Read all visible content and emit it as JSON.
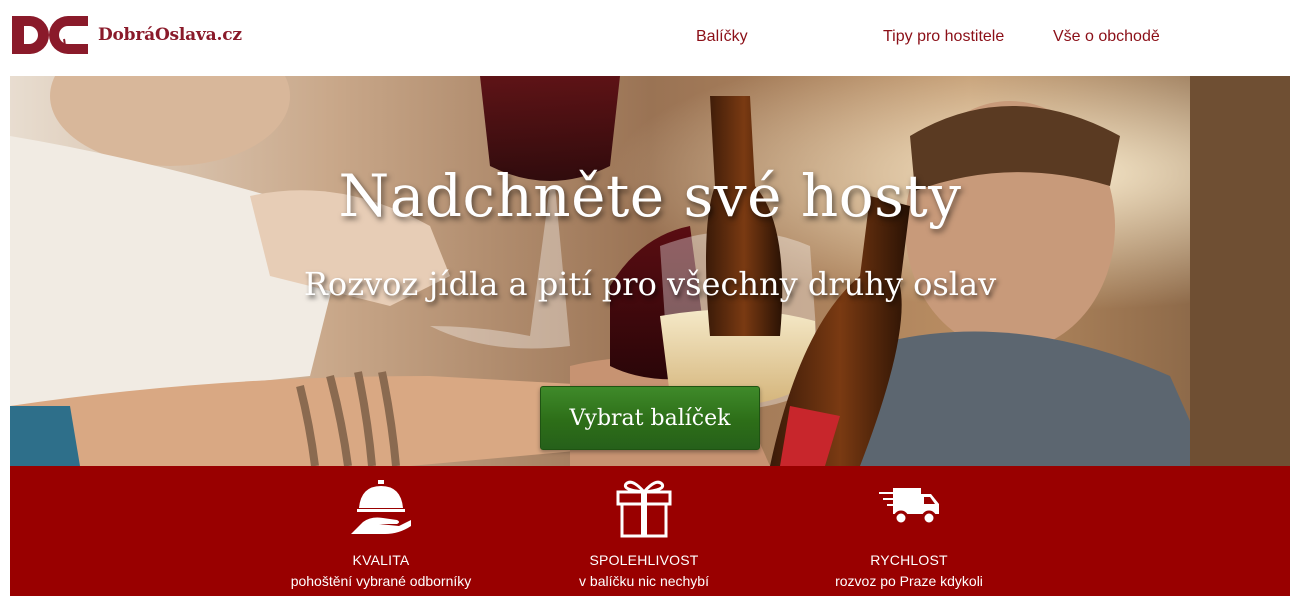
{
  "header": {
    "logo_text": "DobráOslava.cz",
    "nav": [
      "Balíčky",
      "Tipy pro hostitele",
      "Vše o obchodě"
    ]
  },
  "hero": {
    "title": "Nadchněte své hosty",
    "subtitle": "Rozvoz jídla a pití pro všechny druhy oslav",
    "cta": "Vybrat balíček"
  },
  "features": [
    {
      "icon": "cloche-icon",
      "title": "KVALITA",
      "desc": "pohoštění vybrané odborníky"
    },
    {
      "icon": "gift-icon",
      "title": "SPOLEHLIVOST",
      "desc": "v balíčku nic nechybí"
    },
    {
      "icon": "truck-icon",
      "title": "RYCHLOST",
      "desc": "rozvoz po Praze kdykoli"
    }
  ],
  "colors": {
    "brand": "#8b0f17",
    "band": "#990000",
    "cta": "#2d6e18"
  }
}
